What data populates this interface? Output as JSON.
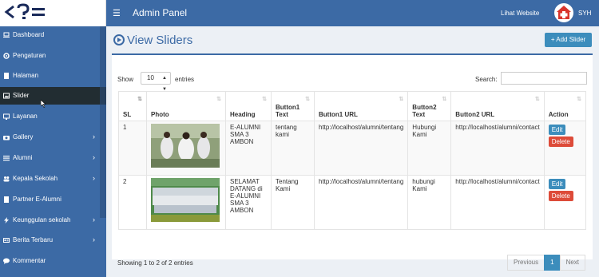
{
  "header": {
    "menu_icon": "hamburger-icon",
    "title": "Admin Panel",
    "link": "Lihat Website",
    "user": "SYH"
  },
  "sidebar": {
    "items": [
      {
        "label": "Dashboard",
        "icon": "laptop-icon",
        "chevron": false
      },
      {
        "label": "Pengaturan",
        "icon": "gear-icon",
        "chevron": false
      },
      {
        "label": "Halaman",
        "icon": "file-icon",
        "chevron": false
      },
      {
        "label": "Slider",
        "icon": "image-icon",
        "chevron": false,
        "active": true
      },
      {
        "label": "Layanan",
        "icon": "monitor-icon",
        "chevron": false
      },
      {
        "label": "Gallery",
        "icon": "camera-icon",
        "chevron": true
      },
      {
        "label": "Alumni",
        "icon": "list-icon",
        "chevron": true
      },
      {
        "label": "Kepala Sekolah",
        "icon": "users-icon",
        "chevron": true
      },
      {
        "label": "Partner E-Alumni",
        "icon": "file-icon",
        "chevron": false
      },
      {
        "label": "Keunggulan sekolah",
        "icon": "bolt-icon",
        "chevron": true
      },
      {
        "label": "Berita Terbaru",
        "icon": "newspaper-icon",
        "chevron": true
      },
      {
        "label": "Kommentar",
        "icon": "comment-icon",
        "chevron": false
      }
    ],
    "chevron_glyph": "›"
  },
  "main": {
    "title": "View Sliders",
    "add_button": "+ Add Slider",
    "show_label": "Show",
    "page_size": "10",
    "entries_label": "entries",
    "search_label": "Search:",
    "search_value": "",
    "columns": [
      "SL",
      "Photo",
      "Heading",
      "Button1 Text",
      "Button1 URL",
      "Button2 Text",
      "Button2 URL",
      "Action"
    ],
    "rows": [
      {
        "sl": "1",
        "heading": "E-ALUMNI SMA 3 AMBON",
        "button1_text": "tentang kami",
        "button1_url": "http://localhost/alumni/tentang",
        "button2_text": "Hubungi Kami",
        "button2_url": "http://localhost/alumni/contact",
        "edit": "Edit",
        "delete": "Delete"
      },
      {
        "sl": "2",
        "heading": "SELAMAT DATANG di E-ALUMNI SMA 3 AMBON",
        "button1_text": "Tentang Kami",
        "button1_url": "http://localhost/alumni/tentang",
        "button2_text": "hubungi Kami",
        "button2_url": "http://localhost/alumni/contact",
        "edit": "Edit",
        "delete": "Delete"
      }
    ],
    "info": "Showing 1 to 2 of 2 entries",
    "pagination": {
      "previous": "Previous",
      "current": "1",
      "next": "Next"
    }
  },
  "colors": {
    "primary": "#3c6aa5",
    "edit": "#3c8dbc",
    "delete": "#dd4b39",
    "active_nav": "#222d32"
  }
}
